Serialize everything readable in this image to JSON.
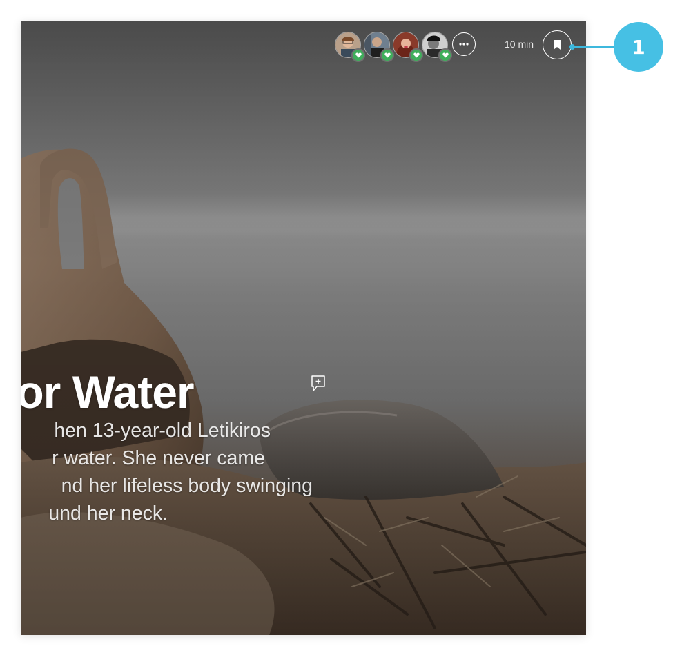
{
  "article": {
    "title": "lk for Water",
    "lede_lines": [
      "hen 13-year-old Letikiros",
      "r water. She never came",
      "nd her lifeless body swinging",
      "und her neck."
    ]
  },
  "header": {
    "avatars": [
      {
        "name": "avatar-reader-1",
        "badge": "heart-icon"
      },
      {
        "name": "avatar-reader-2",
        "badge": "heart-icon"
      },
      {
        "name": "avatar-reader-3",
        "badge": "heart-icon"
      },
      {
        "name": "avatar-reader-4",
        "badge": "heart-icon"
      }
    ],
    "more_icon": "ellipsis-icon",
    "read_time": "10 min",
    "bookmark_icon": "bookmark-icon"
  },
  "comment_icon": "add-comment-icon",
  "callout": {
    "number": "1"
  },
  "colors": {
    "accent": "#46c0e4",
    "heart_badge": "#3fae5b",
    "text": "#ffffff"
  }
}
